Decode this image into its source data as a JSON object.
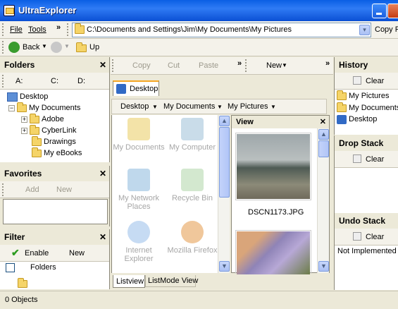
{
  "window": {
    "title": "UltraExplorer"
  },
  "menu": {
    "file": "File",
    "tools": "Tools",
    "chevron": "»"
  },
  "address": {
    "path": "C:\\Documents and Settings\\Jim\\My Documents\\My Pictures",
    "copy_label": "Copy P"
  },
  "nav": {
    "back": "Back",
    "up": "Up"
  },
  "edit_toolbar": {
    "copy": "Copy",
    "cut": "Cut",
    "paste": "Paste",
    "new": "New",
    "chevron": "»"
  },
  "folders_panel": {
    "title": "Folders",
    "drives": [
      {
        "label": "A:"
      },
      {
        "label": "C:"
      },
      {
        "label": "D:"
      }
    ],
    "tree": [
      {
        "label": "Desktop"
      },
      {
        "label": "My Documents"
      },
      {
        "label": "Adobe"
      },
      {
        "label": "CyberLink"
      },
      {
        "label": "Drawings"
      },
      {
        "label": "My eBooks"
      }
    ]
  },
  "favorites_panel": {
    "title": "Favorites",
    "add": "Add",
    "new": "New"
  },
  "filter_panel": {
    "title": "Filter",
    "enable": "Enable",
    "new": "New",
    "item": "Folders"
  },
  "tab": {
    "label": "Desktop"
  },
  "breadcrumb": {
    "items": [
      {
        "label": "Desktop"
      },
      {
        "label": "My Documents"
      },
      {
        "label": "My Pictures"
      }
    ]
  },
  "desktop_items": [
    {
      "label": "My Documents",
      "icon": "my-documents-icon"
    },
    {
      "label": "My Computer",
      "icon": "my-computer-icon"
    },
    {
      "label": "My Network Places",
      "icon": "network-places-icon"
    },
    {
      "label": "Recycle Bin",
      "icon": "recycle-bin-icon"
    },
    {
      "label": "Internet Explorer",
      "icon": "internet-explorer-icon"
    },
    {
      "label": "Mozilla Firefox",
      "icon": "firefox-icon"
    }
  ],
  "view_panel": {
    "title": "View",
    "image1_name": "DSCN1173.JPG"
  },
  "bottom_tabs": {
    "listview": "Listview",
    "listmode": "ListMode View"
  },
  "history_panel": {
    "title": "History",
    "clear": "Clear",
    "items": [
      {
        "label": "My Pictures"
      },
      {
        "label": "My Documents"
      },
      {
        "label": "Desktop"
      }
    ]
  },
  "drop_stack": {
    "title": "Drop Stack",
    "clear": "Clear"
  },
  "undo_stack": {
    "title": "Undo Stack",
    "clear": "Clear",
    "message": "Not Implemented Y"
  },
  "status": {
    "text": "0 Objects"
  },
  "colors": {
    "titlebar": "#0a5fe4",
    "accent": "#316ac5",
    "panel_bg": "#ece9d8"
  }
}
